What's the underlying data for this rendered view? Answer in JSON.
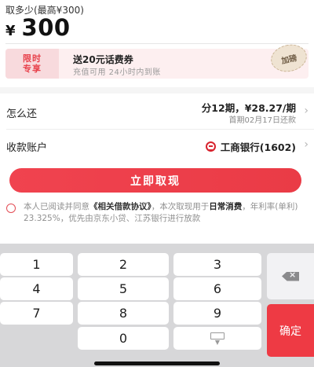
{
  "amount_section": {
    "title": "取多少(最高¥300)",
    "currency": "¥",
    "amount": "300"
  },
  "promo": {
    "tag_line1": "限时",
    "tag_line2": "专享",
    "title": "送20元话费券",
    "subtitle": "充值可用 24小时内到账",
    "stamp": "加磅"
  },
  "repayment": {
    "label": "怎么还",
    "plan": "分12期，¥28.27/期",
    "first_due": "首期02月17日还款"
  },
  "account": {
    "label": "收款账户",
    "bank": "工商银行(1602)"
  },
  "submit_button": "立即取现",
  "agreement": {
    "prefix": "本人已阅读并同意",
    "link": "《相关借款协议》",
    "middle": "，本次取现用于",
    "purpose": "日常消费",
    "suffix": "，年利率(单利) 23.325%，优先由京东小贷、江苏银行进行放款"
  },
  "keypad": {
    "keys": [
      "1",
      "2",
      "3",
      "4",
      "5",
      "6",
      "7",
      "8",
      "9",
      "0"
    ],
    "confirm": "确定"
  },
  "colors": {
    "accent": "#ee3a44",
    "promo_bg": "#fdeff0",
    "keypad_bg": "#d7d7d9"
  }
}
